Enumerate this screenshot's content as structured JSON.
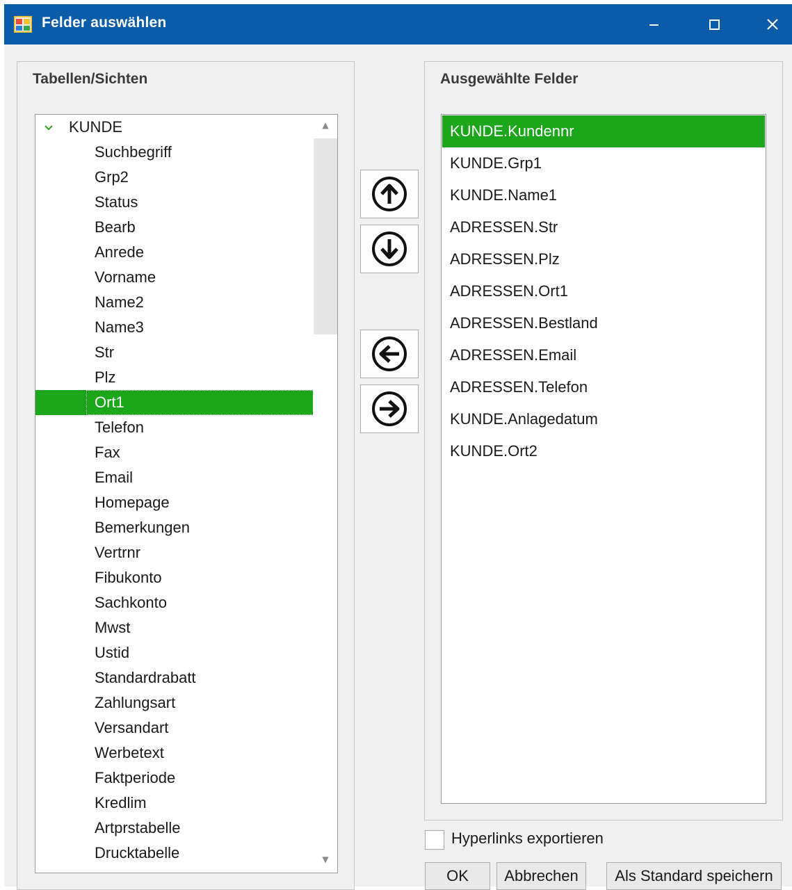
{
  "window": {
    "title": "Felder auswählen",
    "accent_color": "#0b5ca8",
    "selection_color": "#1ca61c"
  },
  "left_panel": {
    "header": "Tabellen/Sichten",
    "tree": {
      "root": "KUNDE",
      "items": [
        "Suchbegriff",
        "Grp2",
        "Status",
        "Bearb",
        "Anrede",
        "Vorname",
        "Name2",
        "Name3",
        "Str",
        "Plz",
        "Ort1",
        "Telefon",
        "Fax",
        "Email",
        "Homepage",
        "Bemerkungen",
        "Vertrnr",
        "Fibukonto",
        "Sachkonto",
        "Mwst",
        "Ustid",
        "Standardrabatt",
        "Zahlungsart",
        "Versandart",
        "Werbetext",
        "Faktperiode",
        "Kredlim",
        "Artprstabelle",
        "Drucktabelle"
      ],
      "selected_item": "Ort1"
    }
  },
  "right_panel": {
    "header": "Ausgewählte Felder",
    "items": [
      "KUNDE.Kundennr",
      "KUNDE.Grp1",
      "KUNDE.Name1",
      "ADRESSEN.Str",
      "ADRESSEN.Plz",
      "ADRESSEN.Ort1",
      "ADRESSEN.Bestland",
      "ADRESSEN.Email",
      "ADRESSEN.Telefon",
      "KUNDE.Anlagedatum",
      "KUNDE.Ort2"
    ],
    "selected_item": "KUNDE.Kundennr"
  },
  "arrow_buttons": {
    "up": "arrow-up-circle-icon",
    "down": "arrow-down-circle-icon",
    "left": "arrow-left-circle-icon",
    "right": "arrow-right-circle-icon"
  },
  "options": {
    "hyperlinks_label": "Hyperlinks exportieren",
    "hyperlinks_checked": false
  },
  "buttons": {
    "ok": "OK",
    "cancel": "Abbrechen",
    "save_default": "Als Standard speichern"
  }
}
